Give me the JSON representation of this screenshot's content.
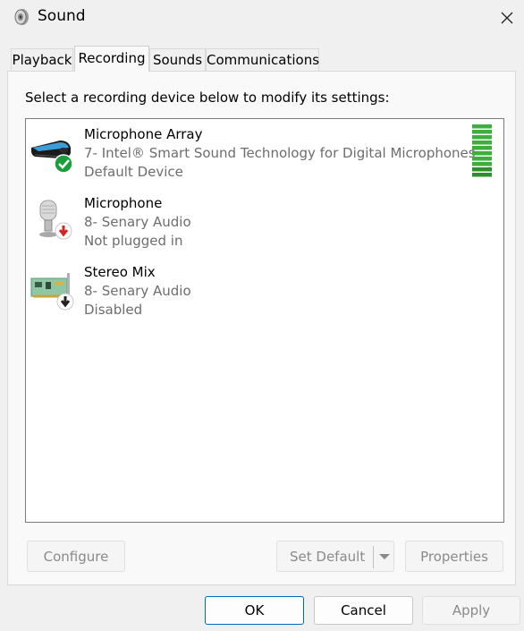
{
  "window": {
    "title": "Sound"
  },
  "tabs": [
    {
      "label": "Playback"
    },
    {
      "label": "Recording"
    },
    {
      "label": "Sounds"
    },
    {
      "label": "Communications"
    }
  ],
  "recording": {
    "instruction": "Select a recording device below to modify its settings:",
    "devices": [
      {
        "name": "Microphone Array",
        "description": "7- Intel® Smart Sound Technology for Digital Microphones",
        "status": "Default Device",
        "icon": "microphone-array-icon",
        "badge": "default-check"
      },
      {
        "name": "Microphone",
        "description": "8- Senary Audio",
        "status": "Not plugged in",
        "icon": "microphone-icon",
        "badge": "unplugged-arrow"
      },
      {
        "name": "Stereo Mix",
        "description": "8- Senary Audio",
        "status": "Disabled",
        "icon": "sound-card-icon",
        "badge": "disabled-arrow"
      }
    ],
    "level_meter": {
      "segments": 10,
      "active_segments": 10,
      "color": "#3fae3f"
    },
    "buttons": {
      "configure": "Configure",
      "set_default": "Set Default",
      "properties": "Properties"
    }
  },
  "dialog_buttons": {
    "ok": "OK",
    "cancel": "Cancel",
    "apply": "Apply"
  },
  "colors": {
    "accent": "#0067c0",
    "check_badge": "#1a9e3a",
    "unplugged_badge": "#d92121"
  }
}
